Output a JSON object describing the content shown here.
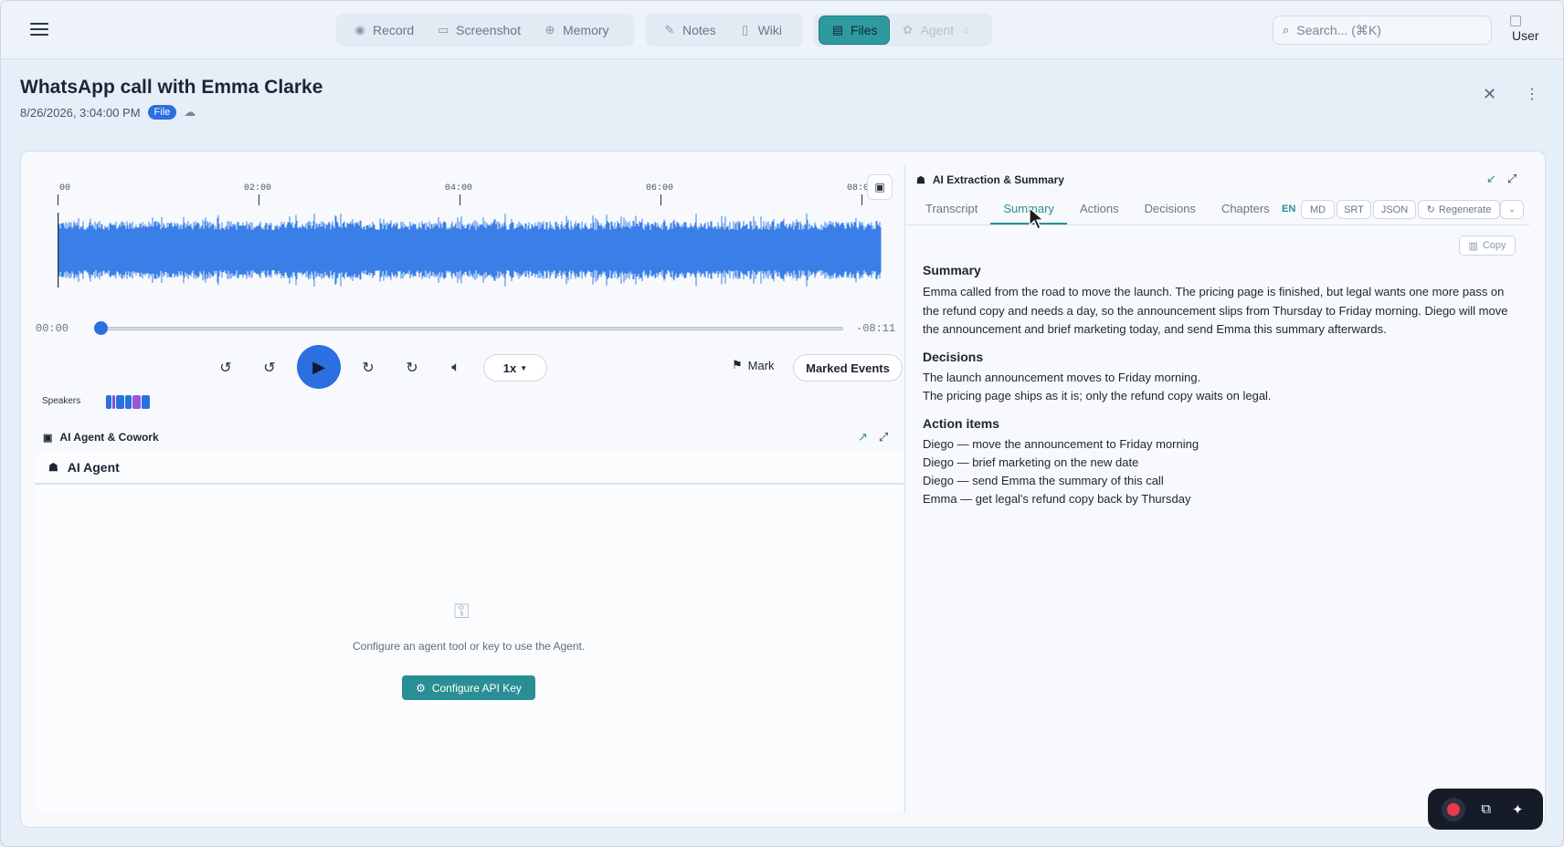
{
  "topbar": {
    "nav_group1": [
      {
        "icon": "record-icon",
        "glyph": "◉",
        "label": "Record"
      },
      {
        "icon": "screenshot-icon",
        "glyph": "▭",
        "label": "Screenshot"
      },
      {
        "icon": "memory-icon",
        "glyph": "⊕",
        "label": "Memory"
      }
    ],
    "nav_group2": [
      {
        "icon": "notes-icon",
        "glyph": "✎",
        "label": "Notes"
      },
      {
        "icon": "wiki-icon",
        "glyph": "▯",
        "label": "Wiki"
      }
    ],
    "files_label": "Files",
    "agent_label": "Agent",
    "search_placeholder": "Search... (⌘K)",
    "user_label": "User"
  },
  "header": {
    "title": "WhatsApp call with Emma Clarke",
    "datetime": "8/26/2026, 3:04:00 PM",
    "badge": "File"
  },
  "player": {
    "ticks": [
      "00",
      "02:00",
      "04:00",
      "06:00",
      "08:0"
    ],
    "time_current": "00:00",
    "time_remaining": "-08:11",
    "progress_fraction": 0.0,
    "speed": "1x",
    "mark_label": "Mark",
    "marked_events_label": "Marked Events",
    "speakers_label": "Speakers",
    "speaker_colors": [
      "#2b6fe0",
      "#7a4fd6",
      "#2b6fe0",
      "#2b6fe0",
      "#9a57d8",
      "#2b6fe0"
    ],
    "wave_color": "#3a7fe8"
  },
  "agent": {
    "section_title": "AI Agent & Cowork",
    "panel_title": "AI Agent",
    "empty_message": "Configure an agent tool or key to use the Agent.",
    "configure_button": "Configure API Key"
  },
  "extraction": {
    "title": "AI Extraction & Summary",
    "tabs": [
      "Transcript",
      "Summary",
      "Actions",
      "Decisions",
      "Chapters"
    ],
    "active_tab": "Summary",
    "lang": "EN",
    "formats": [
      "MD",
      "SRT",
      "JSON"
    ],
    "regenerate_label": "Regenerate",
    "copy_label": "Copy",
    "summary_heading": "Summary",
    "summary_text": "Emma called from the road to move the launch. The pricing page is finished, but legal wants one more pass on the refund copy and needs a day, so the announcement slips from Thursday to Friday morning. Diego will move the announcement and brief marketing today, and send Emma this summary afterwards.",
    "decisions_heading": "Decisions",
    "decisions": [
      "The launch announcement moves to Friday morning.",
      "The pricing page ships as it is; only the refund copy waits on legal."
    ],
    "actions_heading": "Action items",
    "actions": [
      "Diego — move the announcement to Friday morning",
      "Diego — brief marketing on the new date",
      "Diego — send Emma the summary of this call",
      "Emma — get legal's refund copy back by Thursday"
    ]
  },
  "colors": {
    "accent": "#2a8f94",
    "primary_blue": "#2b6fe0",
    "record_red": "#e8394a"
  }
}
